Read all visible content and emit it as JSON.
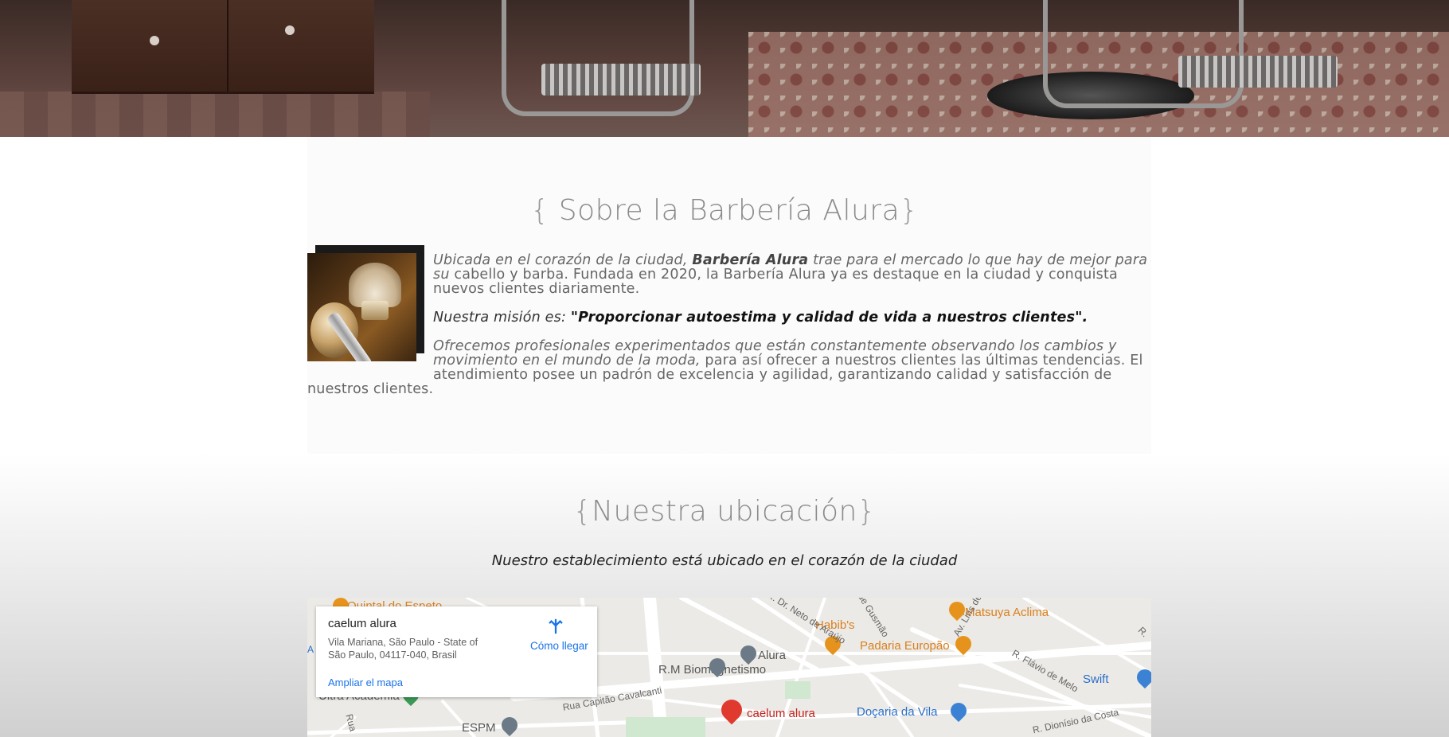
{
  "about": {
    "brace_open": "{",
    "title": " Sobre la Barbería Alura",
    "brace_close": "}",
    "intro_before": "Ubicada en el corazón de la ciudad, ",
    "intro_brand": "Barbería Alura",
    "intro_after": " trae para el mercado lo que hay de mejor para su",
    "intro_line2": "cabello y barba. Fundada en 2020, la Barbería Alura ya es destaque en la ciudad y conquista nuevos clientes diariamente.",
    "mission_label": "Nuestra misión es: ",
    "mission_quote": "\"Proporcionar autoestima y calidad de vida a nuestros clientes\".",
    "para3_italic": "Ofrecemos profesionales experimentados que están constantemente observando los cambios y movimiento en el mundo de la moda,",
    "para3_rest": " para así ofrecer a nuestros clientes las últimas tendencias. El atendimiento posee un padrón de excelencia y agilidad, garantizando calidad y satisfacción de nuestros clientes."
  },
  "location": {
    "brace_open": "{",
    "title": "Nuestra ubicación",
    "brace_close": "}",
    "subtitle": "Nuestro establecimiento está ubicado en el corazón de la ciudad"
  },
  "map": {
    "card": {
      "name": "caelum alura",
      "address": "Vila Mariana, São Paulo - State of São Paulo, 04117-040, Brasil",
      "directions": "Cómo llegar",
      "enlarge": "Ampliar el mapa"
    },
    "pois": {
      "quintal": "Quintal do Espeto",
      "matsuya": "Matsuya Aclima",
      "habibs": "Habib's",
      "padaria": "Padaria Europão",
      "alura": "Alura",
      "rm": "R.M Biomagnetismo",
      "swift": "Swift",
      "ultra": "Ultra Academia",
      "espm": "ESPM",
      "caelum": "caelum alura",
      "docaria": "Doçaria da Vila"
    },
    "streets": {
      "neto": "R. Dr. Neto de Araújo",
      "gusmao": "de Gusmão",
      "lins": "Av. Lins de",
      "flavio": "R. Flávio de Melo",
      "capitao": "Rua Capitão Cavalcanti",
      "dionisio": "R. Dionísio da Costa",
      "rua": "Rua",
      "aa": "A",
      "rr": "R."
    },
    "colors": {
      "poi_orange": "#d9801f",
      "poi_blue": "#2a6fc9",
      "pin_red": "#c5221f",
      "link_blue": "#1a73e8"
    }
  }
}
